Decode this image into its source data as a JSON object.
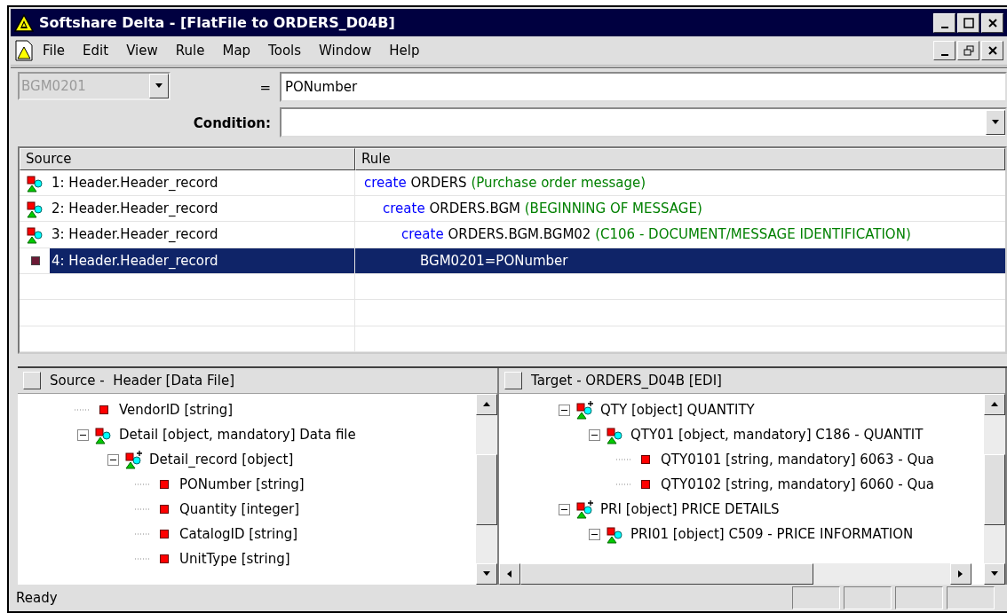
{
  "window": {
    "title": "Softshare Delta - [FlatFile to ORDERS_D04B]"
  },
  "menu": [
    "File",
    "Edit",
    "View",
    "Rule",
    "Map",
    "Tools",
    "Window",
    "Help"
  ],
  "formula": {
    "target": {
      "value": "BGM0201",
      "disabled": true
    },
    "operator": "=",
    "value": "PONumber",
    "condition_label": "Condition:"
  },
  "rules": {
    "columns": [
      "Source",
      "Rule"
    ],
    "rows": [
      {
        "kind": "object",
        "source": "1: Header.Header_record",
        "keyword": "create",
        "target": "ORDERS",
        "comment": "(Purchase order message)",
        "selected": false,
        "children": [
          {
            "kind": "object",
            "source": "2: Header.Header_record",
            "keyword": "create",
            "target": "ORDERS.BGM",
            "comment": "(BEGINNING OF MESSAGE)",
            "selected": false,
            "children": [
              {
                "kind": "object",
                "source": "3: Header.Header_record",
                "keyword": "create",
                "target": "ORDERS.BGM.BGM02",
                "comment": "(C106 - DOCUMENT/MESSAGE IDENTIFICATION)",
                "selected": false,
                "children": [
                  {
                    "kind": "element",
                    "source": "4: Header.Header_record",
                    "target": "BGM0201=PONumber",
                    "selected": true
                  }
                ]
              }
            ]
          }
        ]
      }
    ]
  },
  "source_pane": {
    "title": "Source -  Header [Data File]",
    "tree": [
      {
        "kind": "field",
        "label": "VendorID [string]"
      },
      {
        "kind": "object",
        "label": "Detail [object, mandatory] Data file",
        "expanded": true,
        "children": [
          {
            "kind": "object-new",
            "label": "Detail_record [object]",
            "expanded": true,
            "children": [
              {
                "kind": "field",
                "label": "PONumber [string]"
              },
              {
                "kind": "field",
                "label": "Quantity [integer]"
              },
              {
                "kind": "field",
                "label": "CatalogID [string]"
              },
              {
                "kind": "field",
                "label": "UnitType [string]"
              }
            ]
          }
        ]
      }
    ]
  },
  "target_pane": {
    "title": "Target - ORDERS_D04B [EDI]",
    "tree": [
      {
        "kind": "object-new",
        "label": "QTY [object] QUANTITY",
        "expanded": true,
        "children": [
          {
            "kind": "object",
            "label": "QTY01 [object, mandatory] C186 - QUANTIT",
            "expanded": true,
            "children": [
              {
                "kind": "field",
                "label": "QTY0101 [string, mandatory] 6063 - Qua"
              },
              {
                "kind": "field",
                "label": "QTY0102 [string, mandatory] 6060 - Qua"
              }
            ]
          }
        ]
      },
      {
        "kind": "object-new",
        "label": "PRI [object] PRICE DETAILS",
        "expanded": true,
        "children": [
          {
            "kind": "object",
            "label": "PRI01 [object] C509 - PRICE INFORMATION",
            "expanded": true
          }
        ]
      }
    ]
  },
  "status_bar": {
    "text": "Ready"
  }
}
